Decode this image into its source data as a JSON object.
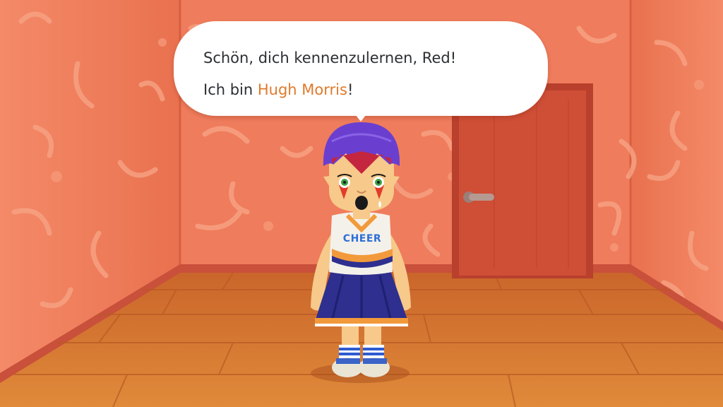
{
  "dialog": {
    "line1": "Schön, dich kennenzulernen, Red!",
    "line2_prefix": "Ich bin ",
    "line2_name": "Hugh Morris",
    "line2_suffix": "!"
  },
  "character": {
    "shirt_text": "CHEER"
  },
  "colors": {
    "wall": "#ef7c5c",
    "wall_dark": "#e0664a",
    "floor": "#d9762e",
    "door": "#c94a33",
    "name_highlight": "#e07a2c",
    "hair": "#6a3fd0",
    "skirt": "#2e2f8e"
  },
  "icons": {
    "door_handle": "door-handle-icon"
  }
}
